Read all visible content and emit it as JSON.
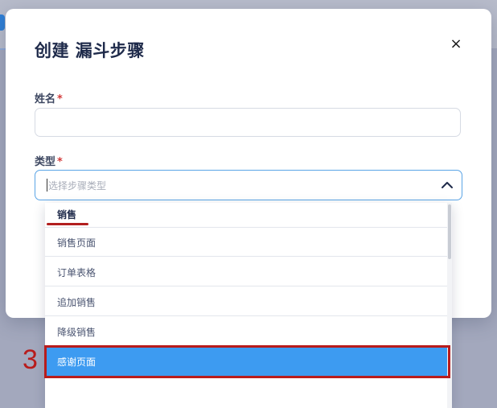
{
  "modal": {
    "title": "创建 漏斗步骤",
    "close_label": "×"
  },
  "form": {
    "name_label": "姓名",
    "type_label": "类型",
    "required_mark": "*",
    "name_value": "",
    "type_placeholder": "选择步骤类型"
  },
  "dropdown": {
    "group_label": "销售",
    "options": [
      {
        "label": "销售页面",
        "selected": false
      },
      {
        "label": "订单表格",
        "selected": false
      },
      {
        "label": "追加销售",
        "selected": false
      },
      {
        "label": "降级销售",
        "selected": false
      },
      {
        "label": "感谢页面",
        "selected": true
      }
    ]
  },
  "annotation": {
    "step_number": "3",
    "color": "#b81c1c"
  },
  "colors": {
    "accent": "#3d9bf1",
    "focus_border": "#5aa4e6",
    "required": "#d23b3b",
    "title": "#1e2a4a"
  }
}
